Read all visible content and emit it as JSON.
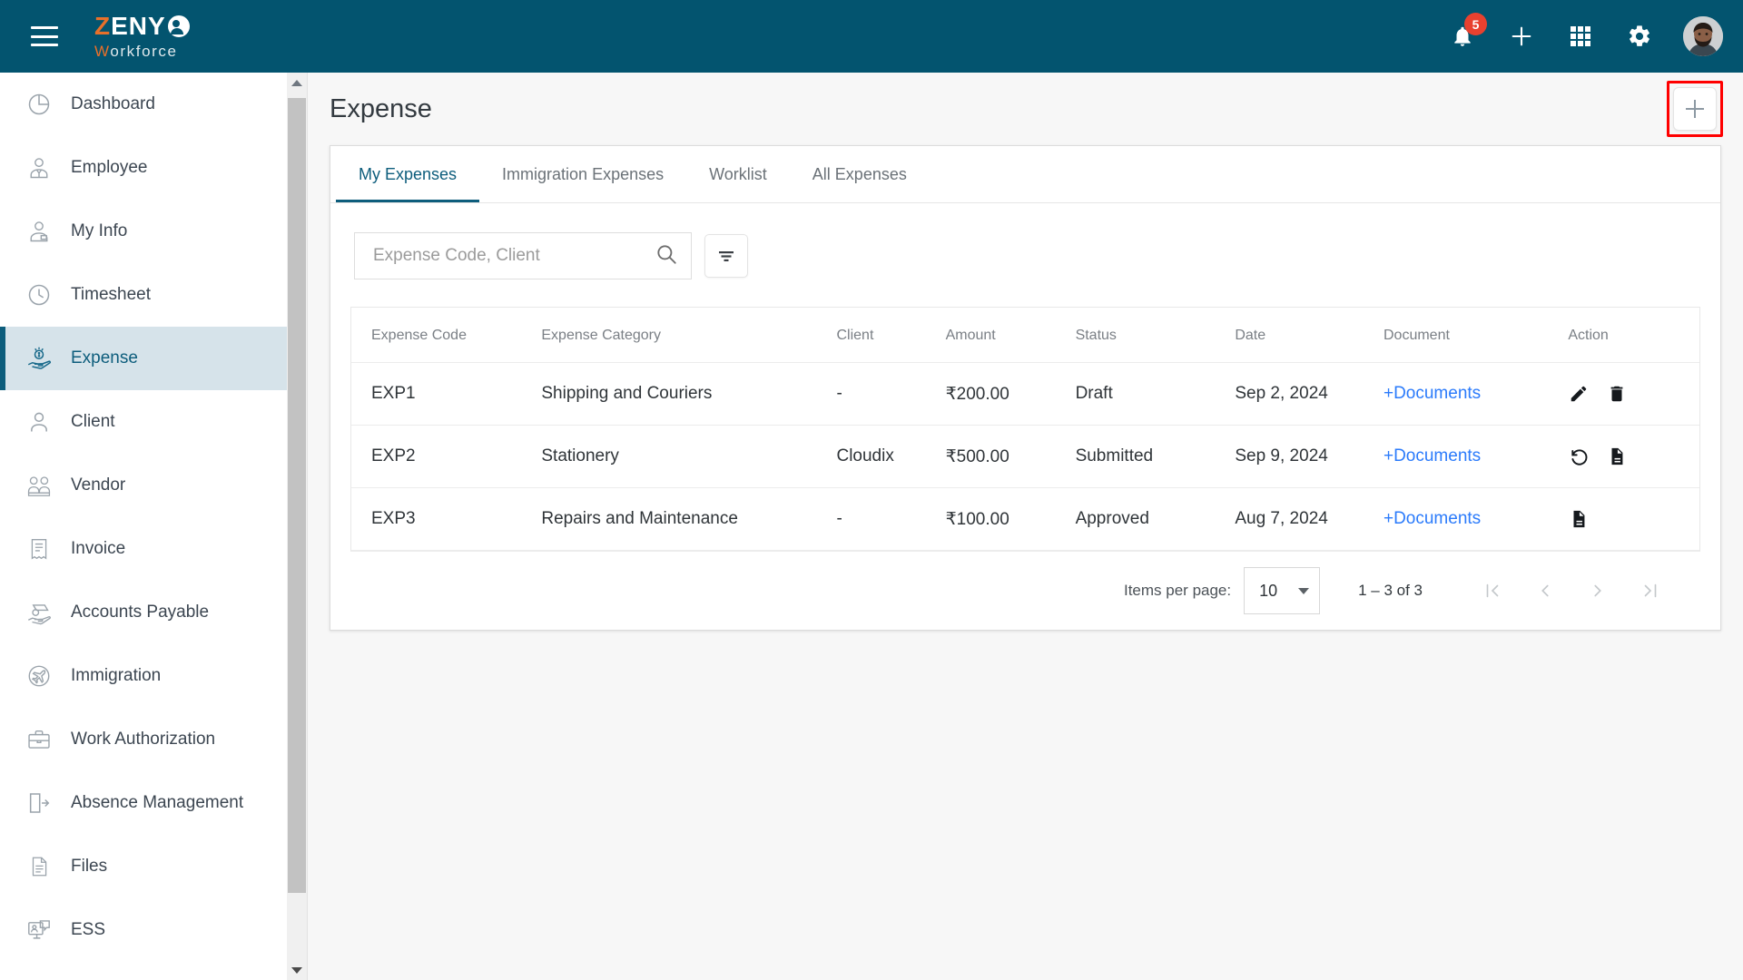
{
  "topbar": {
    "menu_icon": "hamburger-icon",
    "brand": {
      "part1": "Z",
      "part2": "ENY",
      "sub_w": "W",
      "sub_rest": "orkforce"
    },
    "notifications": {
      "icon": "bell-icon",
      "count": "5"
    },
    "add_icon": "plus-icon",
    "apps_icon": "grid-apps-icon",
    "settings_icon": "gear-icon",
    "avatar": "user-avatar"
  },
  "sidebar": {
    "items": [
      {
        "label": "Dashboard",
        "icon": "pie-chart-icon",
        "active": false
      },
      {
        "label": "Employee",
        "icon": "employee-icon",
        "active": false
      },
      {
        "label": "My Info",
        "icon": "person-badge-icon",
        "active": false
      },
      {
        "label": "Timesheet",
        "icon": "clock-icon",
        "active": false
      },
      {
        "label": "Expense",
        "icon": "hand-coin-icon",
        "active": true
      },
      {
        "label": "Client",
        "icon": "person-icon",
        "active": false
      },
      {
        "label": "Vendor",
        "icon": "vendor-icon",
        "active": false
      },
      {
        "label": "Invoice",
        "icon": "receipt-icon",
        "active": false
      },
      {
        "label": "Accounts Payable",
        "icon": "hand-money-icon",
        "active": false
      },
      {
        "label": "Immigration",
        "icon": "airplane-globe-icon",
        "active": false
      },
      {
        "label": "Work Authorization",
        "icon": "briefcase-icon",
        "active": false
      },
      {
        "label": "Absence Management",
        "icon": "door-exit-icon",
        "active": false
      },
      {
        "label": "Files",
        "icon": "document-stack-icon",
        "active": false
      },
      {
        "label": "ESS",
        "icon": "self-service-icon",
        "active": false
      }
    ]
  },
  "page": {
    "title": "Expense",
    "add_button_icon": "plus-icon",
    "add_button_highlighted": true,
    "highlight_color": "#ff0000"
  },
  "tabs": [
    {
      "label": "My Expenses",
      "active": true
    },
    {
      "label": "Immigration Expenses",
      "active": false
    },
    {
      "label": "Worklist",
      "active": false
    },
    {
      "label": "All Expenses",
      "active": false
    }
  ],
  "search": {
    "placeholder": "Expense Code, Client",
    "value": "",
    "icon": "search-icon",
    "filter_icon": "filter-icon"
  },
  "table": {
    "columns": [
      "Expense Code",
      "Expense Category",
      "Client",
      "Amount",
      "Status",
      "Date",
      "Document",
      "Action"
    ],
    "rows": [
      {
        "code": "EXP1",
        "category": "Shipping and Couriers",
        "client": "-",
        "amount": "₹200.00",
        "status": "Draft",
        "date": "Sep 2, 2024",
        "document": "+Documents",
        "actions": [
          "edit-icon",
          "delete-icon"
        ]
      },
      {
        "code": "EXP2",
        "category": "Stationery",
        "client": "Cloudix",
        "amount": "₹500.00",
        "status": "Submitted",
        "date": "Sep 9, 2024",
        "document": "+Documents",
        "actions": [
          "undo-icon",
          "document-icon"
        ]
      },
      {
        "code": "EXP3",
        "category": "Repairs and Maintenance",
        "client": "-",
        "amount": "₹100.00",
        "status": "Approved",
        "date": "Aug 7, 2024",
        "document": "+Documents",
        "actions": [
          "document-icon"
        ]
      }
    ]
  },
  "paginator": {
    "items_per_page_label": "Items per page:",
    "items_per_page_value": "10",
    "range_label": "1 – 3 of 3",
    "first_icon": "first-page-icon",
    "prev_icon": "previous-page-icon",
    "next_icon": "next-page-icon",
    "last_icon": "last-page-icon"
  },
  "colors": {
    "topbar": "#03546f",
    "accent": "#0d5d7c",
    "brand_orange": "#e8702a",
    "badge_red": "#e8412f",
    "link_blue": "#2b7bfb",
    "active_nav_bg": "#d6e3ea"
  }
}
